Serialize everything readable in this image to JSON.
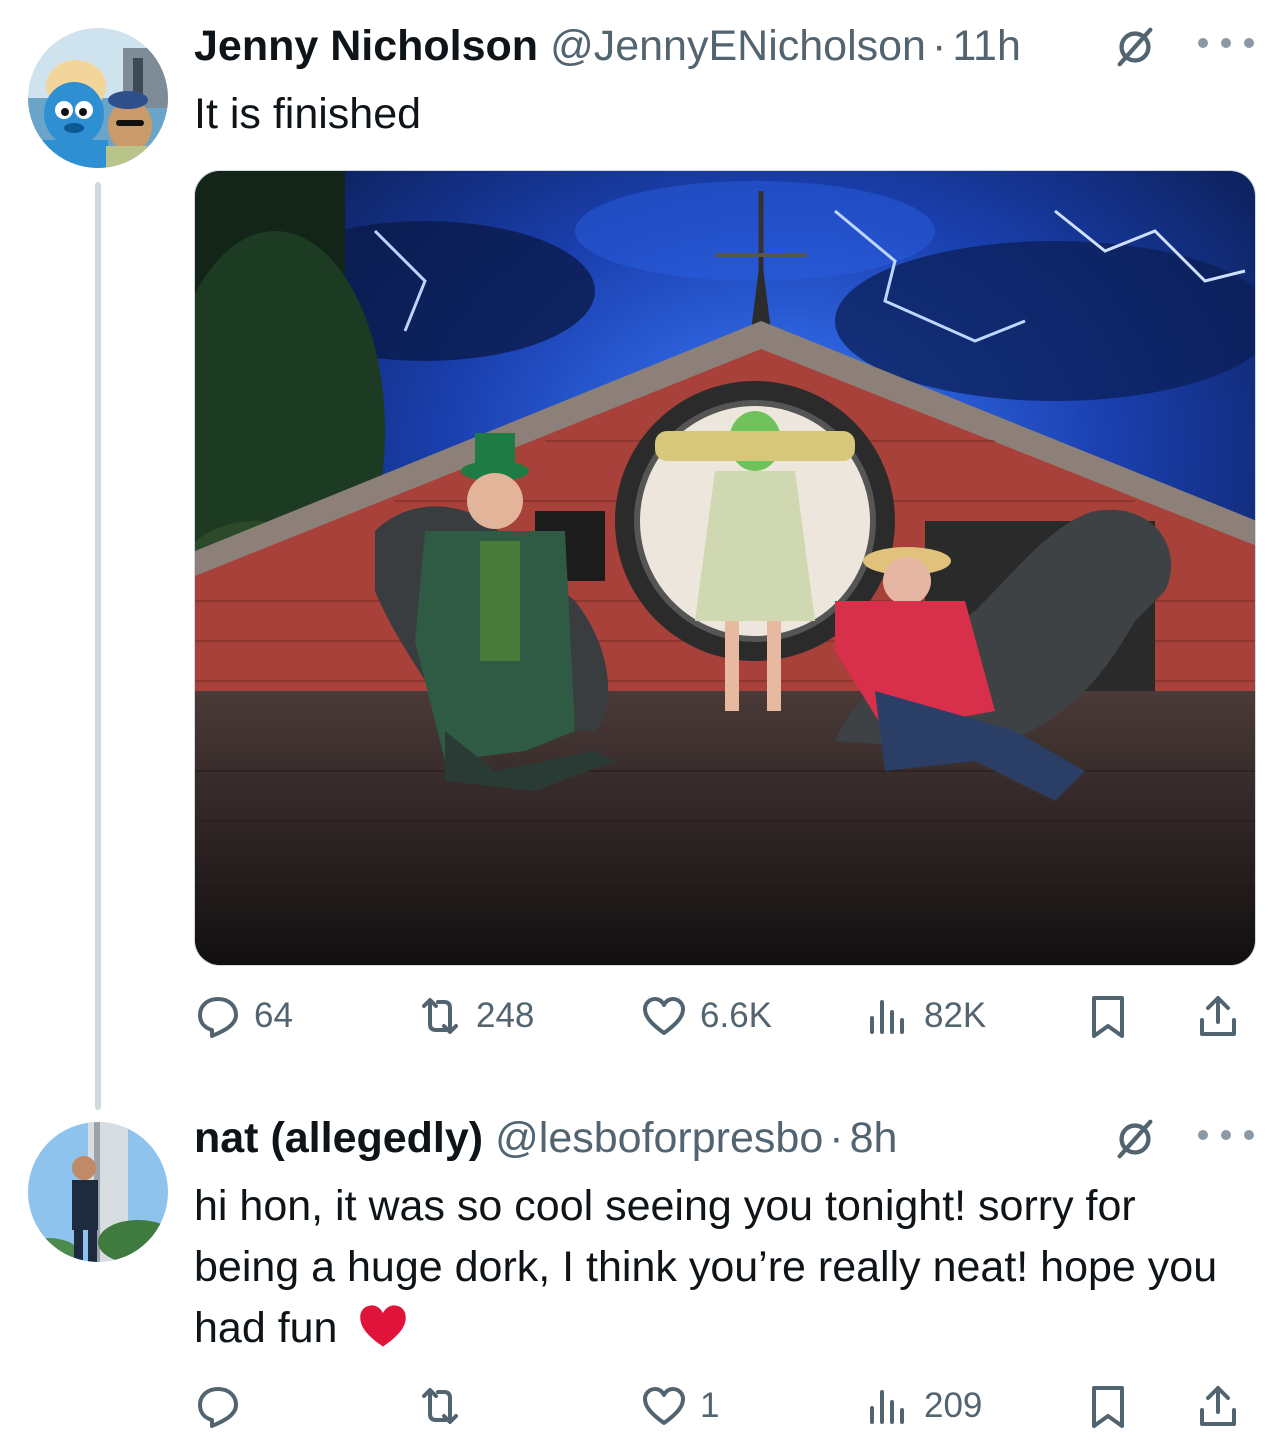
{
  "thread": [
    {
      "author": {
        "name": "Jenny Nicholson",
        "handle": "@JennyENicholson",
        "time": "11h"
      },
      "text": "It is finished",
      "actions": {
        "replies": "64",
        "reposts": "248",
        "likes": "6.6K",
        "views": "82K"
      }
    },
    {
      "author": {
        "name": "nat (allegedly)",
        "handle": "@lesboforpresbo",
        "time": "8h"
      },
      "text": "hi hon, it was so cool seeing you tonight! sorry for being a huge dork, I think you’re really neat! hope you had fun",
      "emoji": "❤️",
      "actions": {
        "replies": "",
        "reposts": "",
        "likes": "1",
        "views": "209"
      }
    }
  ],
  "dot_separator": "·",
  "icons": [
    "reply-icon",
    "repost-icon",
    "like-icon",
    "views-icon",
    "bookmark-icon",
    "share-icon",
    "grok-icon",
    "more-icon",
    "heart-emoji"
  ],
  "colors": {
    "text": "#0f1419",
    "secondary": "#536471",
    "thread_line": "#cfd9de",
    "heart": "#e0143a"
  }
}
